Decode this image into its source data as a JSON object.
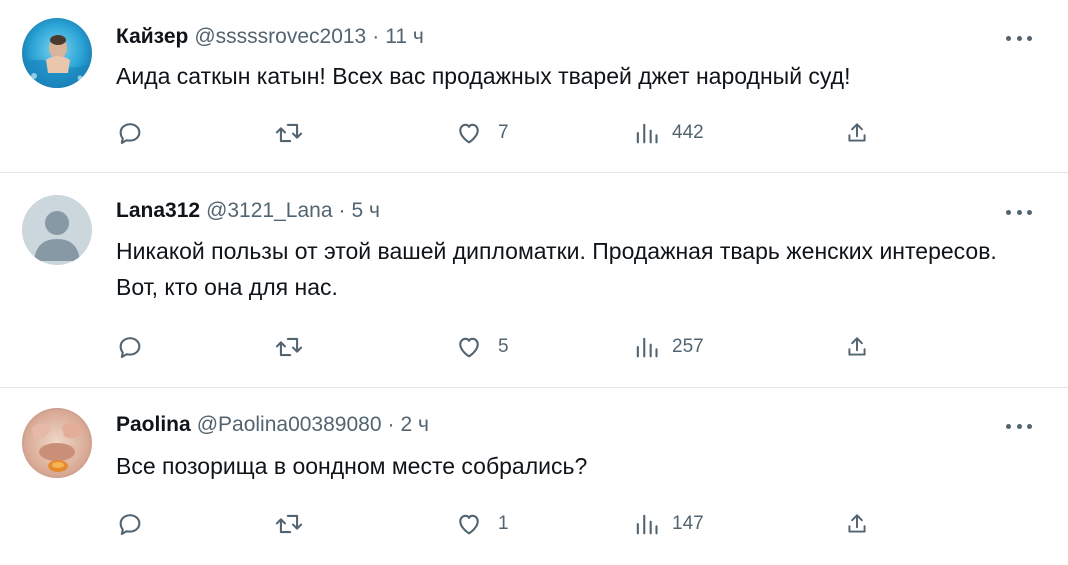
{
  "tweets": [
    {
      "name": "Кайзер",
      "handle": "@sssssrovec2013",
      "separator": "·",
      "time": "11 ч",
      "text": "Аида саткын катын! Всех вас продажных тварей джет народный суд!",
      "likes": "7",
      "views": "442"
    },
    {
      "name": "Lana312",
      "handle": "@3121_Lana",
      "separator": "·",
      "time": "5 ч",
      "text": "Никакой пользы от этой вашей дипломатки. Продажная тварь женских интересов. Вот, кто она для нас.",
      "likes": "5",
      "views": "257"
    },
    {
      "name": "Paolina",
      "handle": "@Paolina00389080",
      "separator": "·",
      "time": "2 ч",
      "text": "Все позорища в оондном месте собрались?",
      "likes": "1",
      "views": "147"
    }
  ],
  "icons": {
    "reply": "reply-icon",
    "retweet": "retweet-icon",
    "like": "heart-icon",
    "views": "views-icon",
    "share": "share-icon",
    "more": "more-icon"
  },
  "colors": {
    "text": "#0f1419",
    "secondary": "#536471",
    "divider": "#e3e6e9"
  }
}
